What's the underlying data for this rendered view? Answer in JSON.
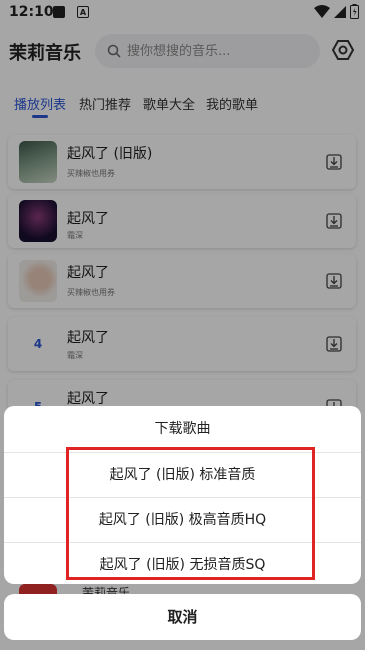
{
  "status": {
    "time": "12:10",
    "a_label": "A"
  },
  "header": {
    "app_title": "茉莉音乐",
    "search_placeholder": "搜你想搜的音乐..."
  },
  "tabs": [
    {
      "label": "播放列表",
      "active": true
    },
    {
      "label": "热门推荐",
      "active": false
    },
    {
      "label": "歌单大全",
      "active": false
    },
    {
      "label": "我的歌单",
      "active": false
    }
  ],
  "songs": [
    {
      "title": "起风了 (旧版)",
      "artist": "买辣椒也用券",
      "cover": "art"
    },
    {
      "title": "起风了",
      "artist": "霜深",
      "cover": "art-dark"
    },
    {
      "title": "起风了",
      "artist": "买辣椒也用券",
      "cover": "art-portrait"
    },
    {
      "title": "起风了",
      "artist": "霜深",
      "cover": "4"
    },
    {
      "title": "起风了",
      "artist": "",
      "cover": "5"
    }
  ],
  "peek_song": {
    "title": "茉莉音乐"
  },
  "sheet": {
    "title": "下载歌曲",
    "options": [
      "起风了 (旧版) 标准音质",
      "起风了 (旧版) 极高音质HQ",
      "起风了 (旧版) 无损音质SQ"
    ],
    "cancel": "取消"
  },
  "colors": {
    "accent": "#2b56d6",
    "highlight": "#e02424"
  }
}
